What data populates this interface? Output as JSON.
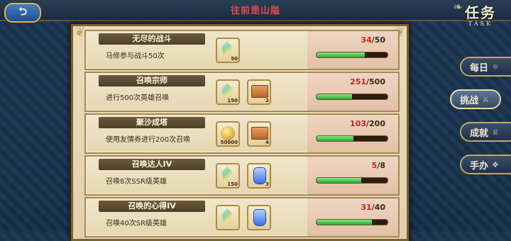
{
  "header": {
    "back_icon": "back-arrow-icon",
    "title": "往前是山隘",
    "page_title": "任务",
    "page_title_en": "TASK"
  },
  "side_tabs": [
    {
      "label": "每日",
      "icon": "☼",
      "active": false
    },
    {
      "label": "挑战",
      "icon": "⚔",
      "active": true
    },
    {
      "label": "成就",
      "icon": "♕",
      "active": false
    },
    {
      "label": "手办",
      "icon": "❖",
      "active": false
    }
  ],
  "missions": [
    {
      "title": "无尽的战斗",
      "desc": "马修参与战斗50次",
      "rewards": [
        {
          "icon": "gem-icon",
          "qty": "50"
        }
      ],
      "current": "34",
      "total": "/50",
      "progress": 0.68
    },
    {
      "title": "召唤宗师",
      "desc": "进行500次英雄召唤",
      "rewards": [
        {
          "icon": "gem-icon",
          "qty": "150"
        },
        {
          "icon": "ticket-icon",
          "qty": "2"
        }
      ],
      "current": "251",
      "total": "/500",
      "progress": 0.502
    },
    {
      "title": "聚沙成塔",
      "desc": "使用友情券进行200次召唤",
      "rewards": [
        {
          "icon": "coin-icon",
          "qty": "50000"
        },
        {
          "icon": "ticket-icon",
          "qty": "4"
        }
      ],
      "current": "103",
      "total": "/200",
      "progress": 0.515
    },
    {
      "title": "召唤达人IV",
      "desc": "召唤8次SSR级英雄",
      "rewards": [
        {
          "icon": "gem-icon",
          "qty": "150"
        },
        {
          "icon": "potion-icon",
          "qty": "3"
        }
      ],
      "current": "5",
      "total": "/8",
      "progress": 0.625
    },
    {
      "title": "召唤的心得IV",
      "desc": "召唤40次SR级英雄",
      "rewards": [
        {
          "icon": "gem-icon",
          "qty": ""
        },
        {
          "icon": "potion-icon",
          "qty": ""
        }
      ],
      "current": "31",
      "total": "/40",
      "progress": 0.775
    }
  ]
}
